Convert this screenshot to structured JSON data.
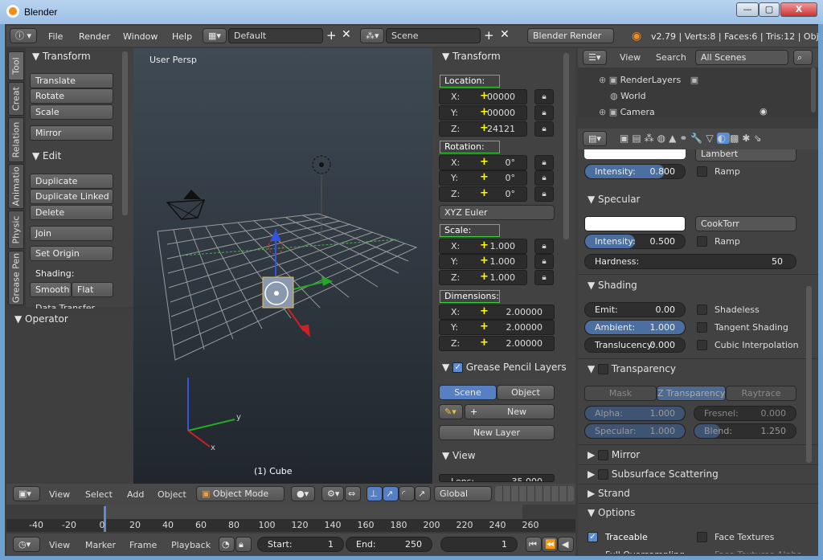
{
  "window": {
    "title": "Blender",
    "min": "—",
    "max": "▢",
    "close": "X"
  },
  "info": {
    "menus": [
      "File",
      "Render",
      "Window",
      "Help"
    ],
    "layout": "Default",
    "scene": "Scene",
    "engine": "Blender Render",
    "stats": "v2.79 | Verts:8 | Faces:6 | Tris:12 | Objects"
  },
  "tabs": [
    "Tool",
    "Creat",
    "Relation",
    "Animatio",
    "Physic",
    "Grease Pen"
  ],
  "toolshelf": {
    "transform_title": "Transform",
    "translate": "Translate",
    "rotate": "Rotate",
    "scale": "Scale",
    "mirror": "Mirror",
    "edit_title": "Edit",
    "duplicate": "Duplicate",
    "duplicate_linked": "Duplicate Linked",
    "delete": "Delete",
    "join": "Join",
    "set_origin": "Set Origin",
    "shading_label": "Shading:",
    "smooth": "Smooth",
    "flat": "Flat",
    "data_transfer": "Data Transfer",
    "operator_title": "Operator"
  },
  "viewport": {
    "label": "User Persp",
    "object": "(1) Cube"
  },
  "npanel": {
    "transform_title": "Transform",
    "location": "Location:",
    "loc": [
      {
        "k": "X:",
        "v": "00000"
      },
      {
        "k": "Y:",
        "v": "00000"
      },
      {
        "k": "Z:",
        "v": "24121"
      }
    ],
    "rotation": "Rotation:",
    "rot": [
      {
        "k": "X:",
        "v": "0°"
      },
      {
        "k": "Y:",
        "v": "0°"
      },
      {
        "k": "Z:",
        "v": "0°"
      }
    ],
    "rot_mode": "XYZ Euler",
    "scale": "Scale:",
    "scl": [
      {
        "k": "X:",
        "v": "1.000"
      },
      {
        "k": "Y:",
        "v": "1.000"
      },
      {
        "k": "Z:",
        "v": "1.000"
      }
    ],
    "dimensions": "Dimensions:",
    "dim": [
      {
        "k": "X:",
        "v": "2.00000"
      },
      {
        "k": "Y:",
        "v": "2.00000"
      },
      {
        "k": "Z:",
        "v": "2.00000"
      }
    ],
    "gp_title": "Grease Pencil Layers",
    "gp_scene": "Scene",
    "gp_object": "Object",
    "gp_new": "New",
    "gp_new_layer": "New Layer",
    "view_title": "View",
    "lens": "Lens:",
    "lens_val": "35.000"
  },
  "outliner": {
    "view": "View",
    "search": "Search",
    "filter": "All Scenes",
    "items": [
      "RenderLayers",
      "World",
      "Camera"
    ]
  },
  "material": {
    "diffuse_shader": "Lambert",
    "diffuse_intensity_k": "Intensity:",
    "diffuse_intensity": "0.800",
    "ramp": "Ramp",
    "specular_title": "Specular",
    "spec_shader": "CookTorr",
    "spec_intensity_k": "Intensity:",
    "spec_intensity": "0.500",
    "hardness_k": "Hardness:",
    "hardness": "50",
    "shading_title": "Shading",
    "emit_k": "Emit:",
    "emit": "0.00",
    "shadeless": "Shadeless",
    "ambient_k": "Ambient:",
    "ambient": "1.000",
    "tangent": "Tangent Shading",
    "transl_k": "Translucency:",
    "transl": "0.000",
    "cubic": "Cubic Interpolation",
    "transparency_title": "Transparency",
    "mask": "Mask",
    "ztrans": "Z Transparency",
    "raytrace": "Raytrace",
    "alpha_k": "Alpha:",
    "alpha": "1.000",
    "fresnel_k": "Fresnel:",
    "fresnel": "0.000",
    "specular_k": "Specular:",
    "specular": "1.000",
    "blend_k": "Blend:",
    "blend": "1.250",
    "mirror": "Mirror",
    "sss": "Subsurface Scattering",
    "strand": "Strand",
    "options": "Options",
    "traceable": "Traceable",
    "face_textures": "Face Textures",
    "full_over": "Full Oversampling",
    "face_alpha": "Face Textures Alpha"
  },
  "view3d_header": {
    "view": "View",
    "select": "Select",
    "add": "Add",
    "object": "Object",
    "mode": "Object Mode",
    "orientation": "Global"
  },
  "timeline": {
    "ticks": [
      "-40",
      "-20",
      "0",
      "20",
      "40",
      "60",
      "80",
      "100",
      "120",
      "140",
      "160",
      "180",
      "200",
      "220",
      "240",
      "260"
    ],
    "view": "View",
    "marker": "Marker",
    "frame": "Frame",
    "playback": "Playback",
    "start_k": "Start:",
    "start": "1",
    "end_k": "End:",
    "end": "250",
    "current": "1"
  }
}
